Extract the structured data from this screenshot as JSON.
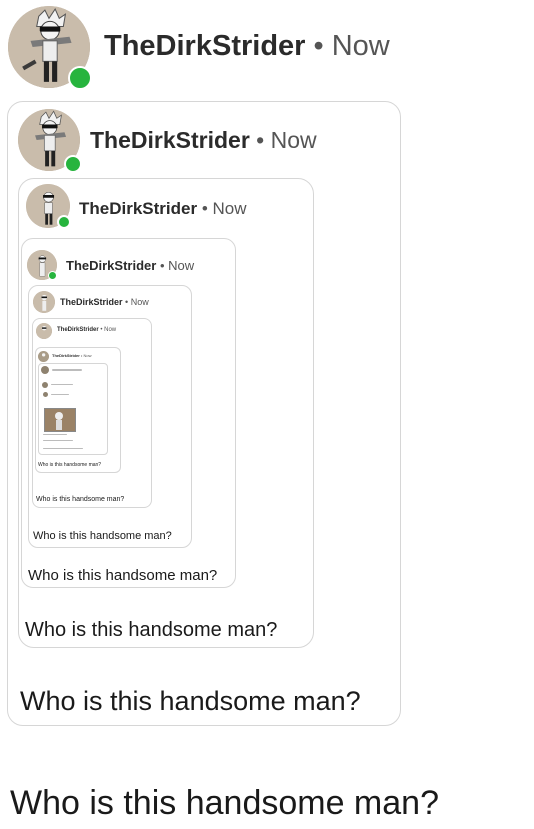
{
  "post": {
    "username": "TheDirkStrider",
    "separator": "•",
    "timestamp": "Now",
    "caption": "Who is this handsome man?",
    "online_color": "#27b43e"
  },
  "nested_depth_visible": 9,
  "icons": {
    "avatar": "avatar-icon",
    "online": "online-status-icon",
    "photo": "photo-thumbnail-icon"
  }
}
